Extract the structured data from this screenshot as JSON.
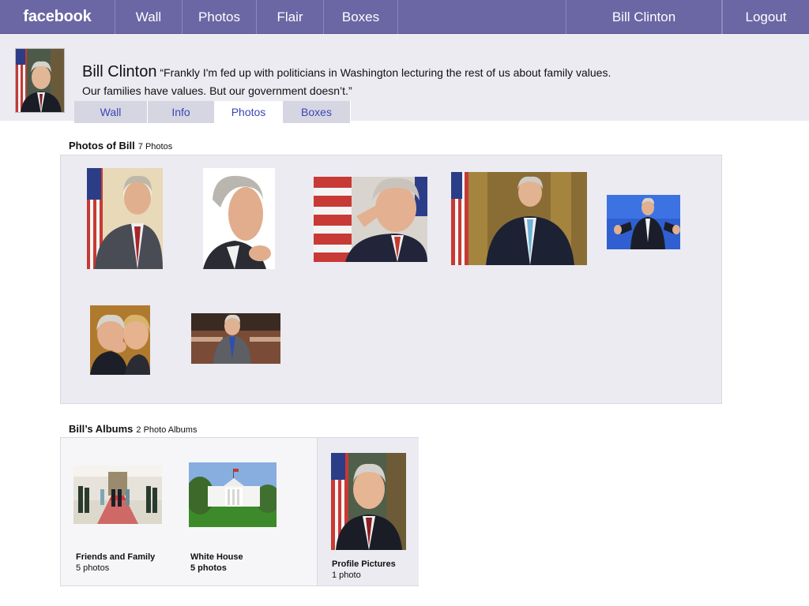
{
  "topnav": {
    "logo": "facebook",
    "items": [
      "Wall",
      "Photos",
      "Flair",
      "Boxes"
    ],
    "user": "Bill Clinton",
    "logout": "Logout"
  },
  "profile": {
    "name": "Bill Clinton",
    "quote": "“Frankly I'm fed up with politicians in Washington lecturing the rest of us about family values. Our families have values. But our government doesn’t.”",
    "tabs": [
      "Wall",
      "Info",
      "Photos",
      "Boxes"
    ],
    "active_tab": "Photos"
  },
  "photos_section": {
    "title": "Photos of Bill",
    "count": "7 Photos"
  },
  "albums_section": {
    "title": "Bill’s Albums",
    "count": "2 Photo Albums",
    "albums": [
      {
        "name": "Friends and Family",
        "count": "5 photos"
      },
      {
        "name": "White House",
        "count": "5 photos"
      },
      {
        "name": "Profile Pictures",
        "count": "1 photo"
      }
    ]
  },
  "colors": {
    "nav_bg": "#6b66a4",
    "band_bg": "#ebebf1",
    "tab_link": "#3b45b8"
  }
}
